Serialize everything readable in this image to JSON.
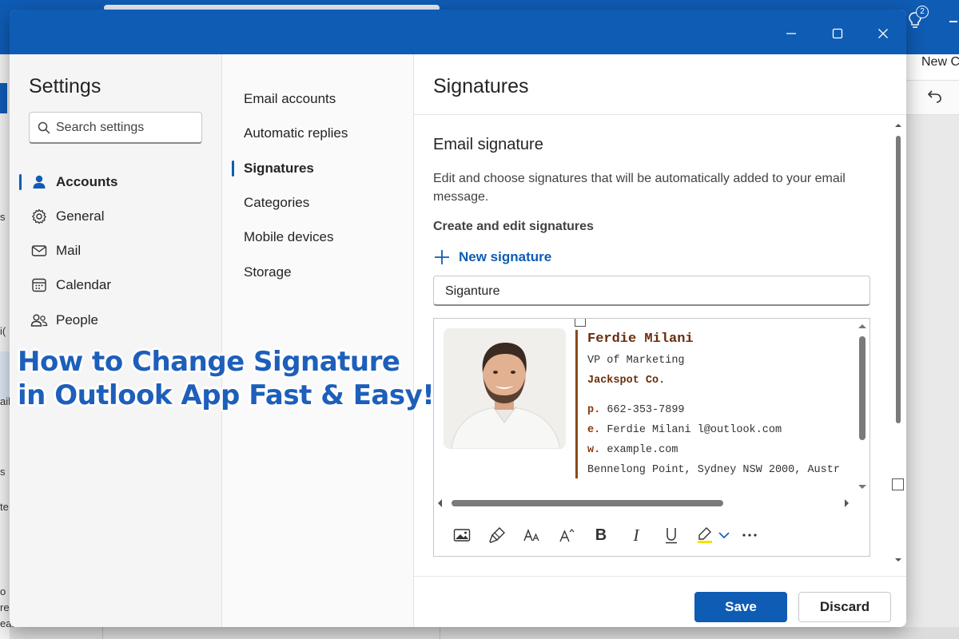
{
  "background": {
    "notification_count": "2",
    "ribbon_new_label": "New C",
    "left_fragments": [
      "s",
      "i(",
      "ail",
      "s",
      "te",
      "o",
      "re",
      "eatures"
    ]
  },
  "window": {
    "minimize_icon": "minimize-icon",
    "maximize_icon": "maximize-icon",
    "close_icon": "close-icon",
    "title_color": "#0f5cb5"
  },
  "settings": {
    "title": "Settings",
    "search_placeholder": "Search settings",
    "categories": [
      {
        "label": "Accounts",
        "icon": "person-icon",
        "active": true
      },
      {
        "label": "General",
        "icon": "gear-icon",
        "active": false
      },
      {
        "label": "Mail",
        "icon": "mail-icon",
        "active": false
      },
      {
        "label": "Calendar",
        "icon": "calendar-icon",
        "active": false
      },
      {
        "label": "People",
        "icon": "people-icon",
        "active": false
      }
    ],
    "subcategories": [
      {
        "label": "Email accounts",
        "active": false
      },
      {
        "label": "Automatic replies",
        "active": false
      },
      {
        "label": "Signatures",
        "active": true
      },
      {
        "label": "Categories",
        "active": false
      },
      {
        "label": "Mobile devices",
        "active": false
      },
      {
        "label": "Storage",
        "active": false
      }
    ]
  },
  "signatures": {
    "title": "Signatures",
    "section_heading": "Email signature",
    "description": "Edit and choose signatures that will be automatically added to your email message.",
    "create_edit_label": "Create and edit signatures",
    "new_signature_label": "New signature",
    "signature_name_value": "Siganture",
    "signature": {
      "name": "Ferdie Milani",
      "role": "VP of Marketing",
      "company": "Jackspot Co.",
      "phone_key": "p.",
      "phone": "662-353-7899",
      "email_key": "e.",
      "email": "Ferdie Milani l@outlook.com",
      "web_key": "w.",
      "web": "example.com",
      "address": "Bennelong Point, Sydney NSW 2000, Austr",
      "accent_color": "#6a2e0c"
    },
    "toolbar_icons": [
      "insert-image-icon",
      "format-painter-icon",
      "font-size-icon",
      "superscript-icon",
      "bold-icon",
      "italic-icon",
      "underline-icon",
      "highlight-icon",
      "chevron-down-icon",
      "more-options-icon"
    ],
    "save_label": "Save",
    "discard_label": "Discard",
    "accent_color": "#0f5cb5"
  },
  "overlay": {
    "line1": "How to Change Signature",
    "line2": "in Outlook App Fast & Easy!",
    "color": "#1d5fba"
  }
}
